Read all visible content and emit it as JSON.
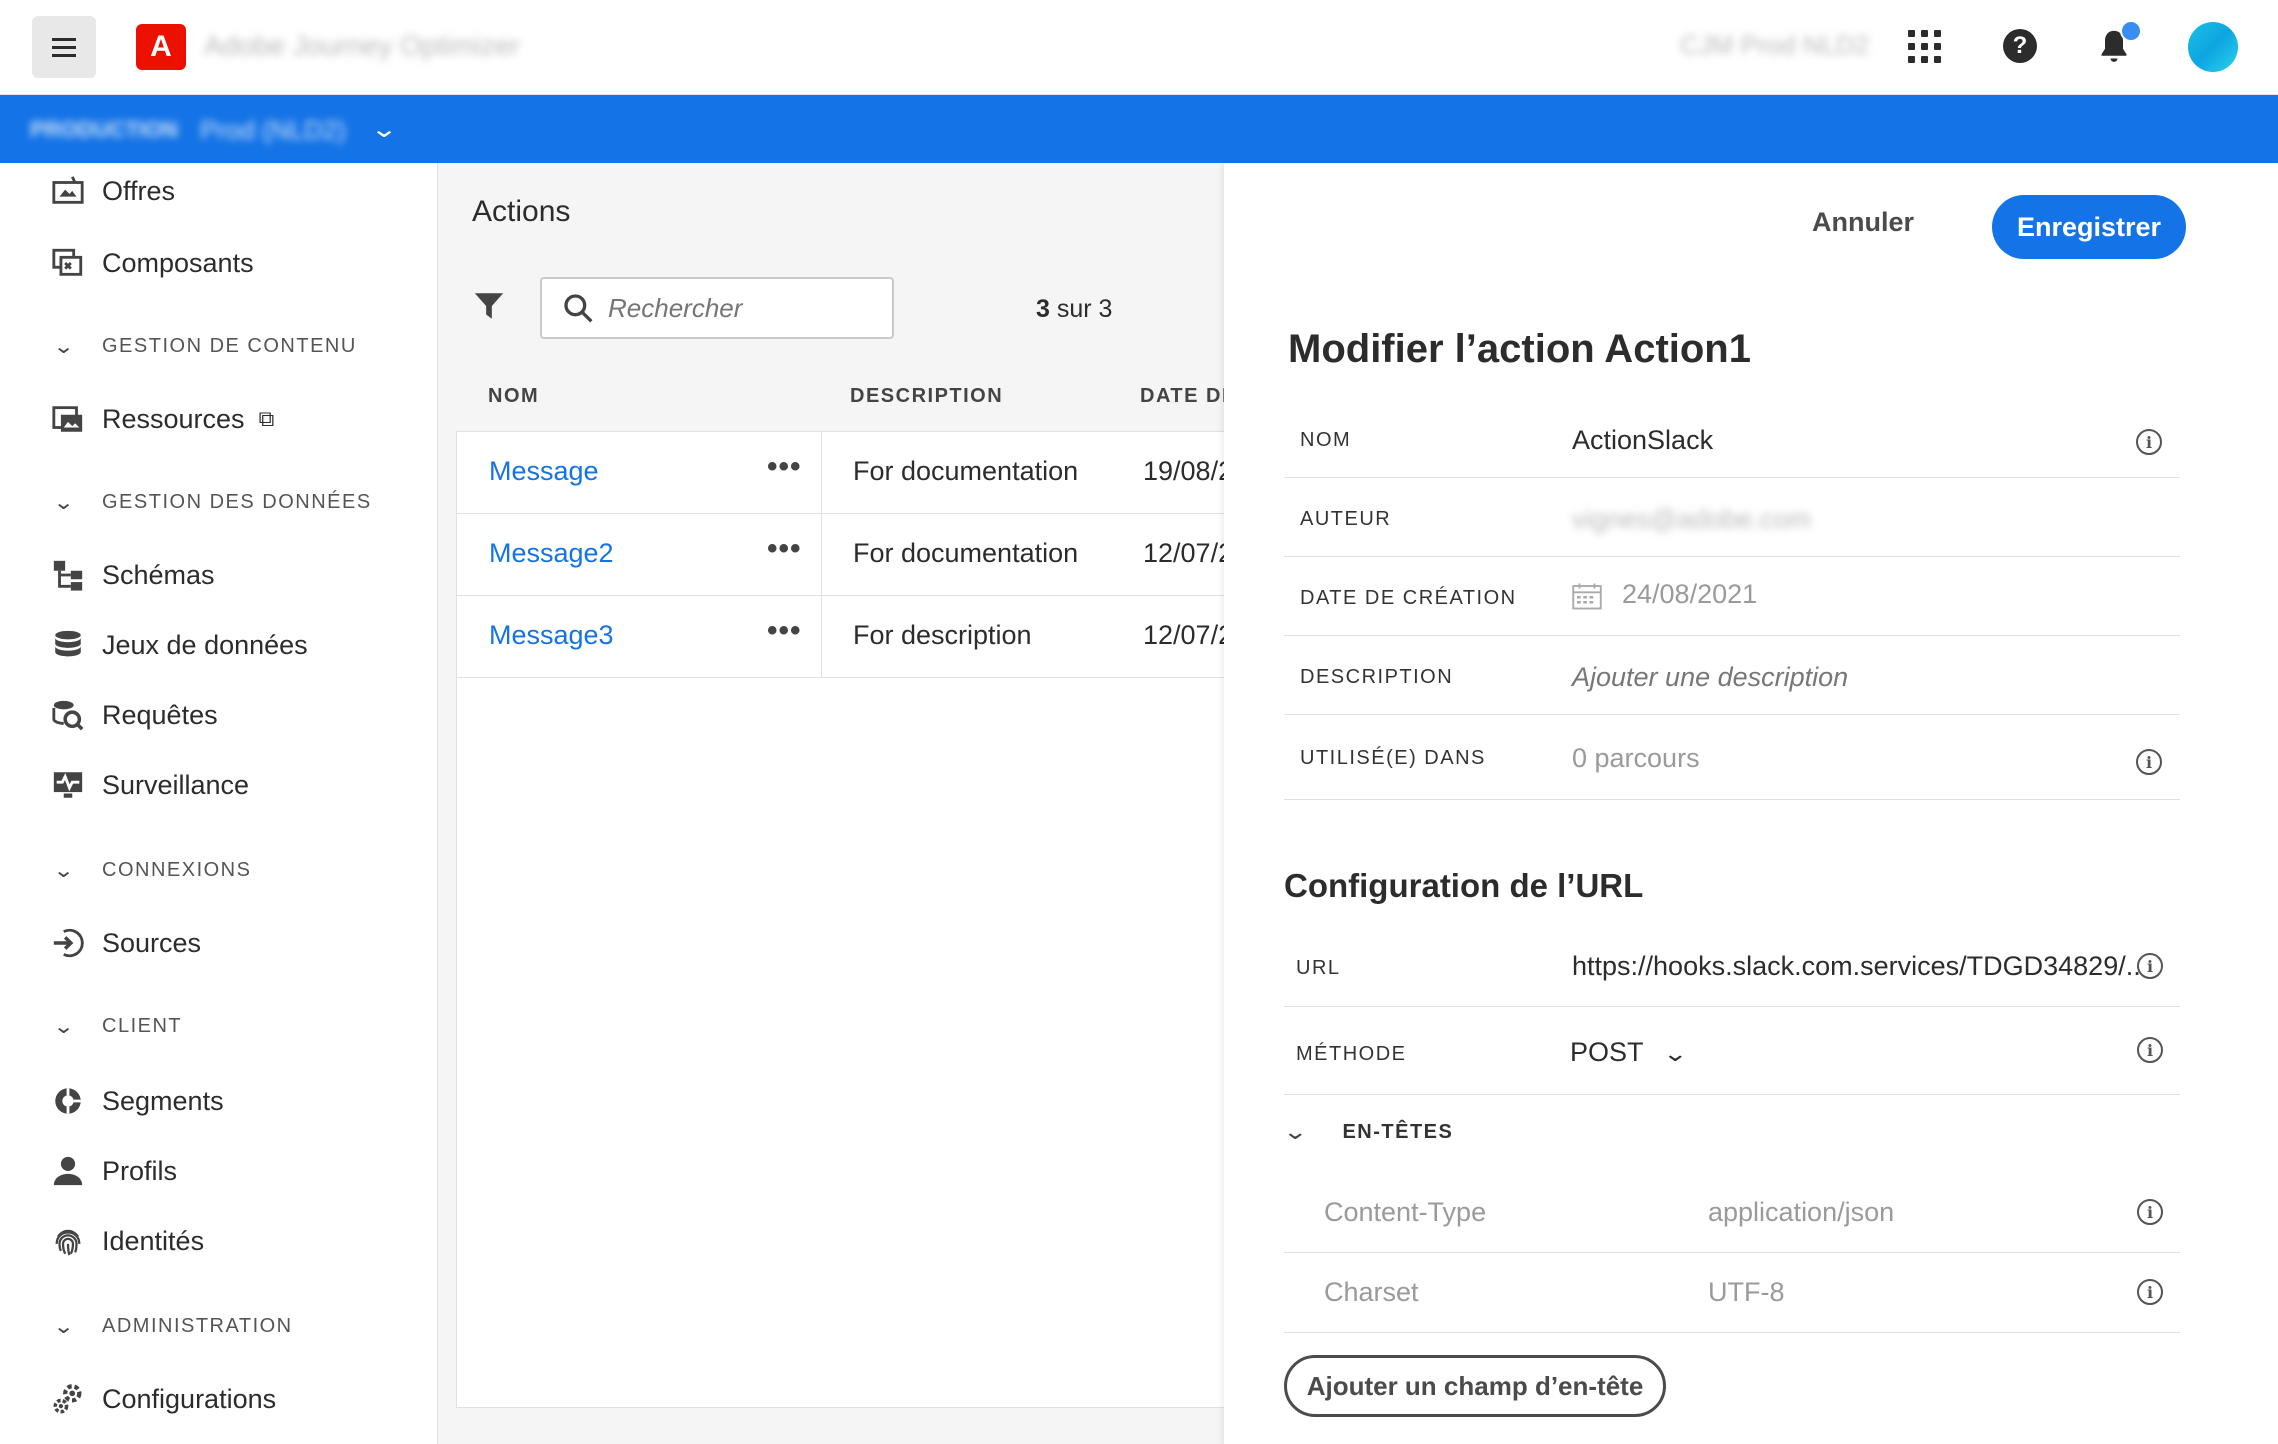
{
  "topbar": {
    "app_title": "Adobe Journey Optimizer",
    "org_name": "CJM Prod NLD2",
    "logo_letter": "A",
    "help_glyph": "?"
  },
  "sandbox": {
    "label": "PRODUCTION",
    "name": "Prod (NLD2)",
    "chevron": "⌄"
  },
  "sidebar": {
    "items_top": [
      {
        "label": "Offres",
        "icon": "offers-icon"
      },
      {
        "label": "Composants",
        "icon": "components-icon"
      }
    ],
    "sections": {
      "content": "GESTION DE CONTENU",
      "data": "GESTION DES DONNÉES",
      "connections": "CONNEXIONS",
      "client": "CLIENT",
      "admin": "ADMINISTRATION"
    },
    "resources": "Ressources",
    "schemas": "Schémas",
    "datasets": "Jeux de données",
    "queries": "Requêtes",
    "monitoring": "Surveillance",
    "sources": "Sources",
    "segments": "Segments",
    "profiles": "Profils",
    "identities": "Identités",
    "configurations": "Configurations",
    "chevron": "⌄",
    "external_glyph": "⧉"
  },
  "actions": {
    "title": "Actions",
    "search_placeholder": "Rechercher",
    "count_current": "3",
    "count_suffix": " sur 3",
    "columns": {
      "name": "NOM",
      "description": "DESCRIPTION",
      "date": "DATE DE"
    },
    "rows": [
      {
        "name": "Message",
        "description": "For documentation",
        "date": "19/08/2"
      },
      {
        "name": "Message2",
        "description": "For documentation",
        "date": "12/07/2"
      },
      {
        "name": "Message3",
        "description": "For description",
        "date": "12/07/2"
      }
    ],
    "more_glyph": "•••"
  },
  "panel": {
    "cancel": "Annuler",
    "save": "Enregistrer",
    "title": "Modifier l’action Action1",
    "fields": {
      "name_label": "NOM",
      "name_value": "ActionSlack",
      "author_label": "AUTEUR",
      "author_value": "vignes@adobe.com",
      "created_label": "DATE DE CRÉATION",
      "created_value": "24/08/2021",
      "description_label": "DESCRIPTION",
      "description_placeholder": "Ajouter une description",
      "used_label": "UTILISÉ(E) DANS",
      "used_value": "0 parcours"
    },
    "url_section": {
      "title": "Configuration de l’URL",
      "url_label": "URL",
      "url_value": "https://hooks.slack.com.services/TDGD34829/..",
      "method_label": "MÉTHODE",
      "method_value": "POST",
      "headers_label": "EN-TÊTES",
      "headers": [
        {
          "key": "Content-Type",
          "value": "application/json"
        },
        {
          "key": "Charset",
          "value": "UTF-8"
        }
      ],
      "add_header": "Ajouter un champ d’en-tête"
    },
    "info_glyph": "i",
    "chevron": "⌄"
  }
}
